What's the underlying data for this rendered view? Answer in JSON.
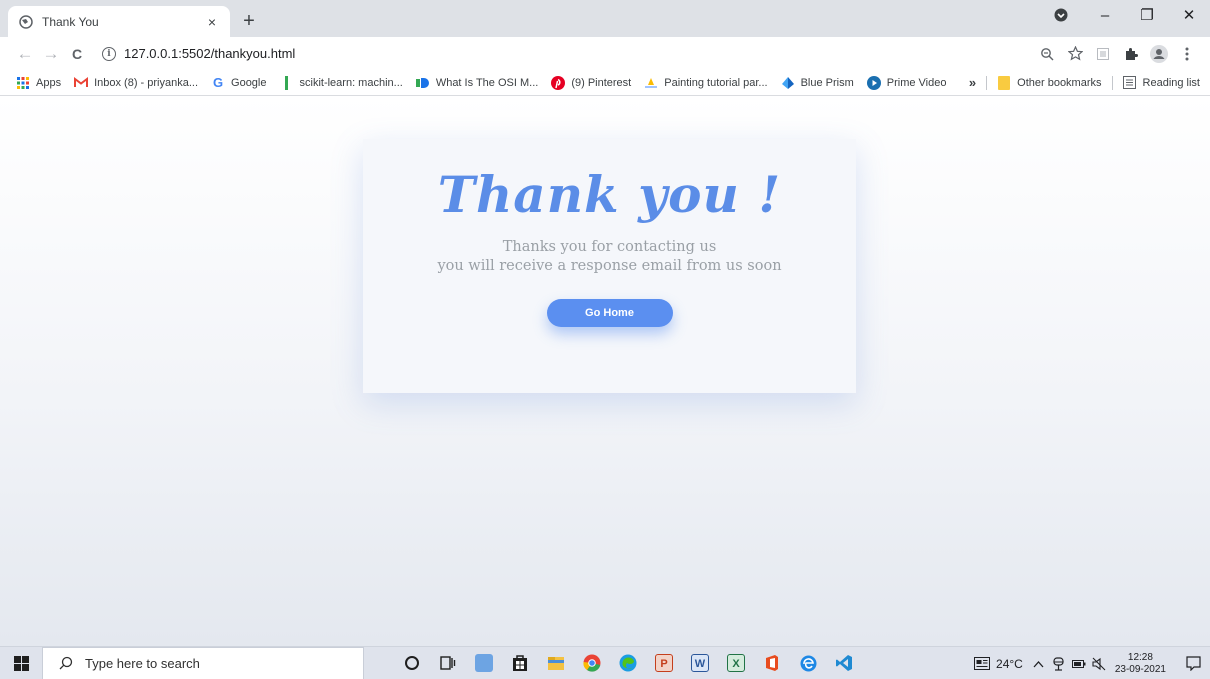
{
  "browser": {
    "tab_title": "Thank You",
    "tab_close": "×",
    "new_tab": "+",
    "minimize": "–",
    "restore": "❐",
    "close": "✕",
    "back": "←",
    "forward": "→",
    "reload": "C",
    "info_glyph": "i",
    "url": "127.0.0.1:5502/thankyou.html"
  },
  "bookmarks": {
    "items": [
      {
        "label": "Apps",
        "icon": "apps-grid-icon"
      },
      {
        "label": "Inbox (8) - priyanka...",
        "icon": "gmail-icon"
      },
      {
        "label": "Google",
        "icon": "google-icon"
      },
      {
        "label": "scikit-learn: machin...",
        "icon": "bookmark-bar-icon"
      },
      {
        "label": "What Is The OSI M...",
        "icon": "d-logo-icon"
      },
      {
        "label": "(9) Pinterest",
        "icon": "pinterest-icon"
      },
      {
        "label": "Painting tutorial par...",
        "icon": "painting-icon"
      },
      {
        "label": "Blue Prism",
        "icon": "blue-prism-icon"
      },
      {
        "label": "Prime Video",
        "icon": "prime-video-icon"
      }
    ],
    "overflow": "»",
    "other": "Other bookmarks",
    "reading_list": "Reading list"
  },
  "card": {
    "title": "Thank you !",
    "message_line1": "Thanks you for contacting us",
    "message_line2": "you will receive a response email from us soon",
    "button_label": "Go Home"
  },
  "taskbar": {
    "search_placeholder": "Type here to search",
    "weather": "24°C",
    "time": "12:28",
    "date": "23-09-2021"
  },
  "colors": {
    "accent": "#5b8de7",
    "button": "#5b8ff0",
    "message": "#9aa0a6"
  }
}
